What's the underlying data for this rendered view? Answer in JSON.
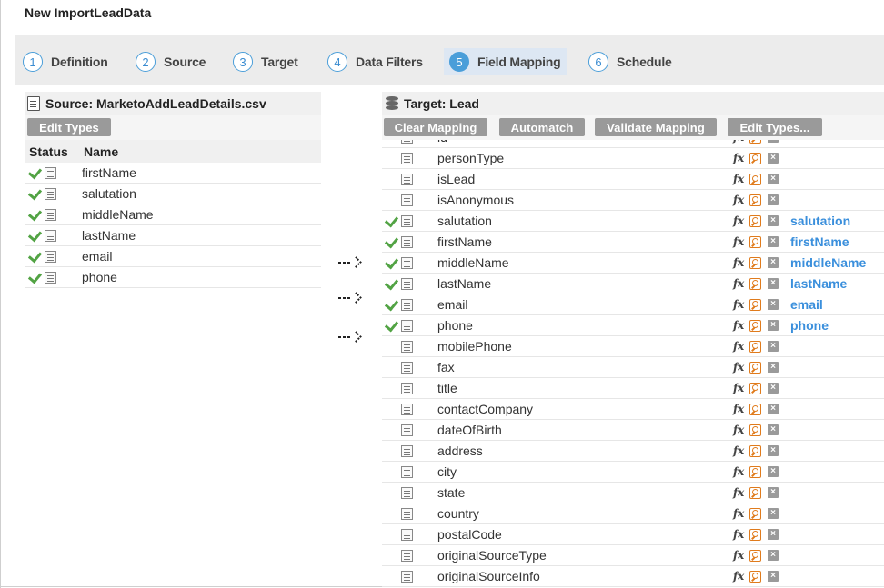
{
  "app_title": "New ImportLeadData",
  "wizard": {
    "steps": [
      {
        "num": "1",
        "label": "Definition"
      },
      {
        "num": "2",
        "label": "Source"
      },
      {
        "num": "3",
        "label": "Target"
      },
      {
        "num": "4",
        "label": "Data Filters"
      },
      {
        "num": "5",
        "label": "Field Mapping",
        "active": true
      },
      {
        "num": "6",
        "label": "Schedule"
      }
    ]
  },
  "source": {
    "title": "Source: MarketoAddLeadDetails.csv",
    "edit_types": "Edit Types",
    "col_status": "Status",
    "col_name": "Name",
    "fields": [
      "firstName",
      "salutation",
      "middleName",
      "lastName",
      "email",
      "phone"
    ]
  },
  "target": {
    "title": "Target: Lead",
    "buttons": {
      "clear_mapping": "Clear Mapping",
      "automatch": "Automatch",
      "validate_mapping": "Validate Mapping",
      "edit_types": "Edit Types..."
    },
    "fx_label": "fx",
    "clear_label": "×",
    "fields": [
      {
        "name": "id",
        "mapped": ""
      },
      {
        "name": "personType",
        "mapped": ""
      },
      {
        "name": "isLead",
        "mapped": ""
      },
      {
        "name": "isAnonymous",
        "mapped": ""
      },
      {
        "name": "salutation",
        "mapped": "salutation"
      },
      {
        "name": "firstName",
        "mapped": "firstName"
      },
      {
        "name": "middleName",
        "mapped": "middleName"
      },
      {
        "name": "lastName",
        "mapped": "lastName"
      },
      {
        "name": "email",
        "mapped": "email"
      },
      {
        "name": "phone",
        "mapped": "phone"
      },
      {
        "name": "mobilePhone",
        "mapped": ""
      },
      {
        "name": "fax",
        "mapped": ""
      },
      {
        "name": "title",
        "mapped": ""
      },
      {
        "name": "contactCompany",
        "mapped": ""
      },
      {
        "name": "dateOfBirth",
        "mapped": ""
      },
      {
        "name": "address",
        "mapped": ""
      },
      {
        "name": "city",
        "mapped": ""
      },
      {
        "name": "state",
        "mapped": ""
      },
      {
        "name": "country",
        "mapped": ""
      },
      {
        "name": "postalCode",
        "mapped": ""
      },
      {
        "name": "originalSourceType",
        "mapped": ""
      },
      {
        "name": "originalSourceInfo",
        "mapped": ""
      }
    ]
  },
  "colors": {
    "accent": "#4a9ed9",
    "mapped_text": "#3a8fdc",
    "check": "#52a344",
    "lookup": "#e07b1c"
  },
  "icons": {
    "check": "check-icon",
    "field": "field-icon",
    "lookup": "lookup-icon",
    "formula": "fx-icon",
    "clear": "clear-icon",
    "arrow": "dotted-arrow-icon"
  }
}
